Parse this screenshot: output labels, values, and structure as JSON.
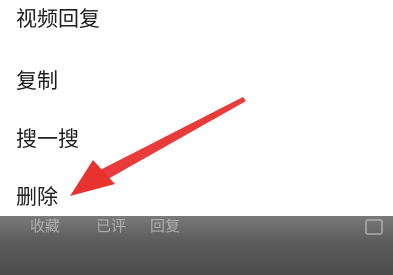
{
  "menu": {
    "items": [
      {
        "label": "视频回复"
      },
      {
        "label": "复制"
      },
      {
        "label": "搜一搜"
      },
      {
        "label": "删除"
      }
    ]
  },
  "bottom_bar": {
    "items": [
      {
        "label": "收藏"
      },
      {
        "label": "已评"
      },
      {
        "label": "回复"
      }
    ]
  },
  "colors": {
    "menu_text": "#1f1f1f",
    "arrow": "#e8322f",
    "overlay": "#5e5e5e"
  }
}
